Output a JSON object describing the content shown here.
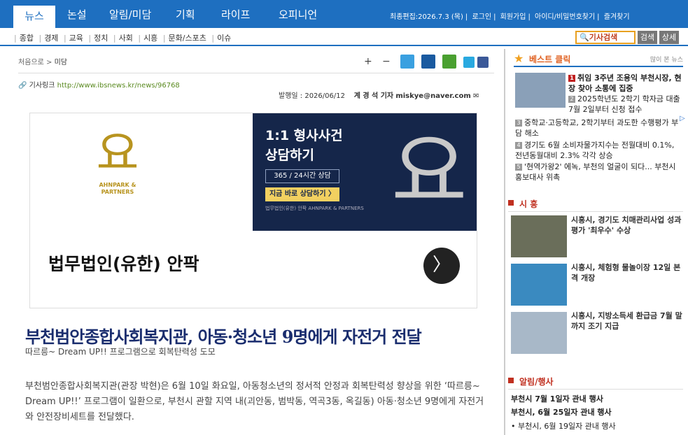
{
  "nav": {
    "tabs": [
      "뉴스",
      "논설",
      "알림/미담",
      "기획",
      "라이프",
      "오피니언"
    ],
    "util": [
      "최종편집:2026.7.3 (목)",
      "로그인",
      "회원가입",
      "아이디/비밀번호찾기",
      "즐겨찾기"
    ],
    "sub": [
      "종합",
      "경제",
      "교육",
      "정치",
      "사회",
      "시흥",
      "문화/스포츠",
      "이슈"
    ],
    "search_label": "기사검색",
    "search_btn": "검색",
    "detail_btn": "상세"
  },
  "article": {
    "breadcrumb_home": "처음으로",
    "breadcrumb_current": "미담",
    "link_label": "기사링크",
    "link_url": "http://www.ibsnews.kr/news/96768",
    "date_label": "발행일 : 2026/06/12",
    "reporter": "계 경 석  기자",
    "email": "miskye@naver.com",
    "title": "부천범안종합사회복지관, 아동·청소년 9명에게 자전거 전달",
    "subtitle": "따르릉~ Dream UP!! 프로그램으로 회복탄력성 도모",
    "body": "부천범안종합사회복지관(관장 박현)은 6월 10일 화요일, 아동청소년의 정서적 안정과 회복탄력성 향상을 위한 ‘따르릉~ Dream UP!!’ 프로그램이 일환으로, 부천시 관할 지역 내(괴안동, 범박동, 역곡3동, 옥길동) 아동·청소년 9명에게 자전거와 안전장비세트를 전달했다."
  },
  "ad": {
    "brand_symbol": "요",
    "brand_name": "AHNPARK & PARTNERS",
    "headline1": "1:1 형사사건",
    "headline2": "상담하기",
    "pill1": "365 / 24시간 상담",
    "pill2": "지금 바로 상담하기 〉",
    "footer": "법무법인(유한) 안팍 AHNPARK & PARTNERS",
    "name": "법무법인(유한) 안팍",
    "arrow": "〉"
  },
  "sidebar": {
    "best_title": "베스트 클릭",
    "best_more": "많이 본 뉴스",
    "best": [
      {
        "num": "1",
        "text": "취임 3주년 조용익 부천시장, 현장 찾아 소통에 집중"
      },
      {
        "num": "2",
        "text": "2025학년도 2학기 학자금 대출 7월 2일부터 신청 접수"
      },
      {
        "num": "3",
        "text": "중학교·고등학교, 2학기부터 과도한 수행평가 부담 해소"
      },
      {
        "num": "4",
        "text": "경기도 6월 소비자물가지수는 전월대비 0.1%, 전년동월대비 2.3% 각각 상승"
      },
      {
        "num": "5",
        "text": "'현역가왕2' 에녹, 부천의 얼굴이 되다... 부천시 홍보대사 위촉"
      }
    ],
    "siheung_title": "시 흥",
    "siheung": [
      "시흥시, 경기도 치매관리사업 성과평가 '최우수' 수상",
      "시흥시, 체험형 물놀이장 12일 본격 개장",
      "시흥시, 지방소득세 환급금 7월 말까지 조기 지급"
    ],
    "notice_title": "알림/행사",
    "notices": [
      "부천시 7월 1일자 관내 행사",
      "부천시, 6월 25일자 관내 행사",
      "• 부천시, 6월 19일자 관내 행사"
    ]
  }
}
